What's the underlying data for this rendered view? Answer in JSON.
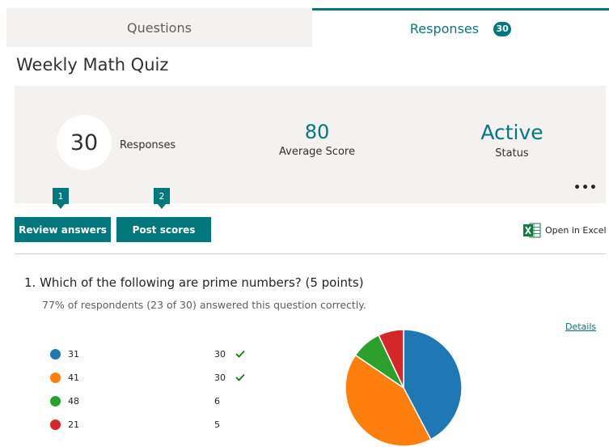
{
  "tabs": {
    "questions_label": "Questions",
    "responses_label": "Responses",
    "responses_badge": "30"
  },
  "form": {
    "title": "Weekly Math Quiz"
  },
  "summary": {
    "responses_count": "30",
    "responses_label": "Responses",
    "average_score": "80",
    "average_score_label": "Average Score",
    "status": "Active",
    "status_label": "Status",
    "more_label": "•••"
  },
  "callouts": [
    "1",
    "2"
  ],
  "actions": {
    "review_label": "Review answers",
    "post_label": "Post scores",
    "excel_label": "Open in Excel"
  },
  "question": {
    "title": "1.  Which of the following are prime numbers? (5 points)",
    "summary": "77% of respondents (23 of 30) answered this question correctly.",
    "details_label": "Details",
    "options": [
      {
        "label": "31",
        "count": "30",
        "correct": true,
        "color": "#1f77b4"
      },
      {
        "label": "41",
        "count": "30",
        "correct": true,
        "color": "#ff7f0e"
      },
      {
        "label": "48",
        "count": "6",
        "correct": false,
        "color": "#2ca02c"
      },
      {
        "label": "21",
        "count": "5",
        "correct": false,
        "color": "#d62728"
      }
    ]
  },
  "chart_data": {
    "type": "pie",
    "categories": [
      "31",
      "41",
      "48",
      "21"
    ],
    "values": [
      30,
      30,
      6,
      5
    ],
    "colors": [
      "#1f77b4",
      "#ff7f0e",
      "#2ca02c",
      "#d62728"
    ]
  },
  "colors": {
    "accent": "#03787c",
    "correct_check": "#107c10"
  }
}
